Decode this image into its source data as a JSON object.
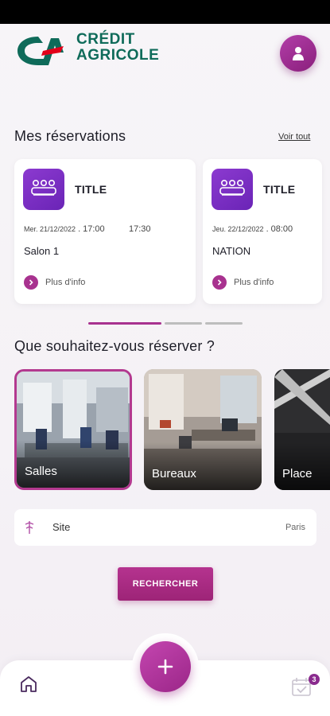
{
  "brand": {
    "line1": "CRÉDIT",
    "line2": "AGRICOLE"
  },
  "reservations": {
    "title": "Mes réservations",
    "see_all": "Voir tout",
    "cards": [
      {
        "title": "TITLE",
        "date": "Mer. 21/12/2022",
        "start": "17:00",
        "end": "17:30",
        "room": "Salon 1",
        "more": "Plus d'info"
      },
      {
        "title": "TITLE",
        "date": "Jeu. 22/12/2022",
        "start": "08:00",
        "end": "",
        "room": "NATION",
        "more": "Plus d'info"
      }
    ]
  },
  "book": {
    "title": "Que souhaitez-vous réserver ?",
    "tiles": [
      {
        "label": "Salles",
        "selected": true
      },
      {
        "label": "Bureaux",
        "selected": false
      },
      {
        "label": "Place",
        "selected": false
      }
    ]
  },
  "site": {
    "label": "Site",
    "value": "Paris"
  },
  "search_label": "RECHERCHER",
  "nav": {
    "badge": "3"
  },
  "colors": {
    "accent": "#a8328f",
    "purple": "#7a2fc4",
    "brand_green": "#0f6b5a",
    "brand_red": "#e2001a"
  },
  "icons": [
    "user-icon",
    "meeting-room-icon",
    "chevron-right-icon",
    "location-pin-icon",
    "plus-icon",
    "home-icon",
    "calendar-check-icon"
  ]
}
